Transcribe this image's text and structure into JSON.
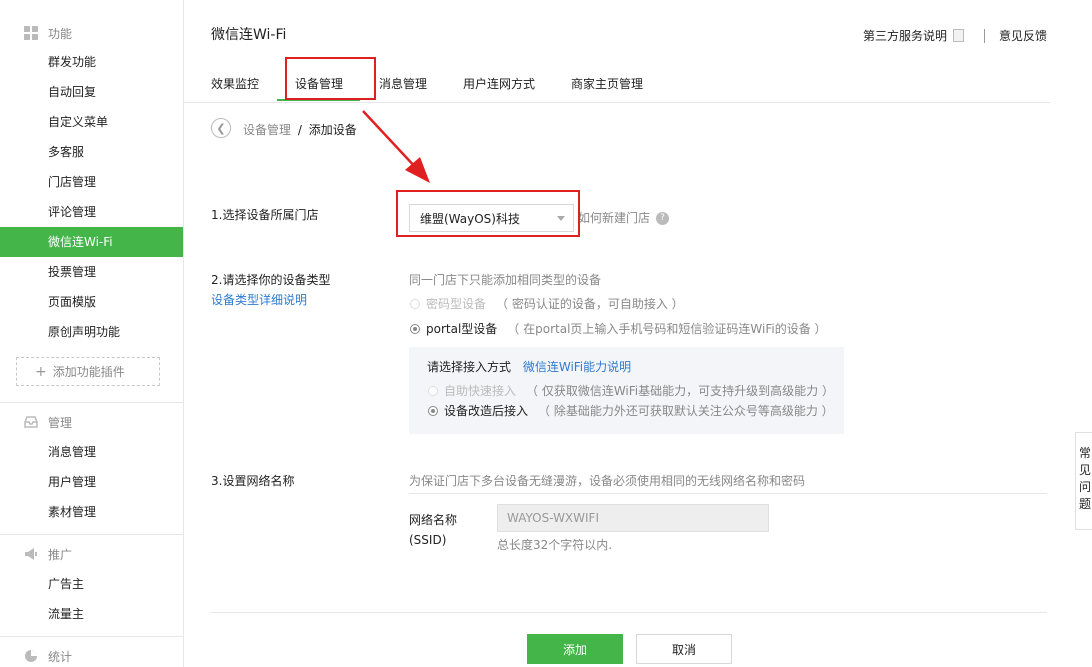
{
  "sidebar": {
    "function_header": "功能",
    "function_items": [
      "群发功能",
      "自动回复",
      "自定义菜单",
      "多客服",
      "门店管理",
      "评论管理",
      "微信连Wi-Fi",
      "投票管理",
      "页面模版",
      "原创声明功能"
    ],
    "active_item": "微信连Wi-Fi",
    "add_plugin": "添加功能插件",
    "manage_header": "管理",
    "manage_items": [
      "消息管理",
      "用户管理",
      "素材管理"
    ],
    "promo_header": "推广",
    "promo_items": [
      "广告主",
      "流量主"
    ],
    "stats_header": "统计"
  },
  "header": {
    "title": "微信连Wi-Fi",
    "third_party": "第三方服务说明",
    "feedback": "意见反馈"
  },
  "tabs": [
    "效果监控",
    "设备管理",
    "消息管理",
    "用户连网方式",
    "商家主页管理"
  ],
  "active_tab": "设备管理",
  "breadcrumb": {
    "parent": "设备管理",
    "separator": "/",
    "current": "添加设备"
  },
  "step1": {
    "label": "1.选择设备所属门店",
    "selected_store": "维盟(WayOS)科技",
    "new_store_link": "如何新建门店"
  },
  "step2": {
    "label": "2.请选择你的设备类型",
    "detail_link": "设备类型详细说明",
    "hint": "同一门店下只能添加相同类型的设备",
    "option_password": "密码型设备",
    "option_password_desc": "（ 密码认证的设备，可自助接入 ）",
    "option_portal": "portal型设备",
    "option_portal_desc": "（ 在portal页上输入手机号码和短信验证码连WiFi的设备 ）",
    "access_label": "请选择接入方式",
    "access_link": "微信连WiFi能力说明",
    "access_quick": "自助快速接入",
    "access_quick_desc": "（ 仅获取微信连WiFi基础能力，可支持升级到高级能力 ）",
    "access_modify": "设备改造后接入",
    "access_modify_desc": "（ 除基础能力外还可获取默认关注公众号等高级能力 ）"
  },
  "step3": {
    "label": "3.设置网络名称",
    "hint": "为保证门店下多台设备无缝漫游，设备必须使用相同的无线网络名称和密码",
    "ssid_label_1": "网络名称",
    "ssid_label_2": "(SSID)",
    "ssid_value": "WAYOS-WXWIFI",
    "ssid_note": "总长度32个字符以内."
  },
  "buttons": {
    "add": "添加",
    "cancel": "取消"
  },
  "float_tab": [
    "常",
    "见",
    "问",
    "题"
  ],
  "colors": {
    "accent": "#44b549",
    "link": "#2e7bd0",
    "annotation": "#e02020"
  }
}
